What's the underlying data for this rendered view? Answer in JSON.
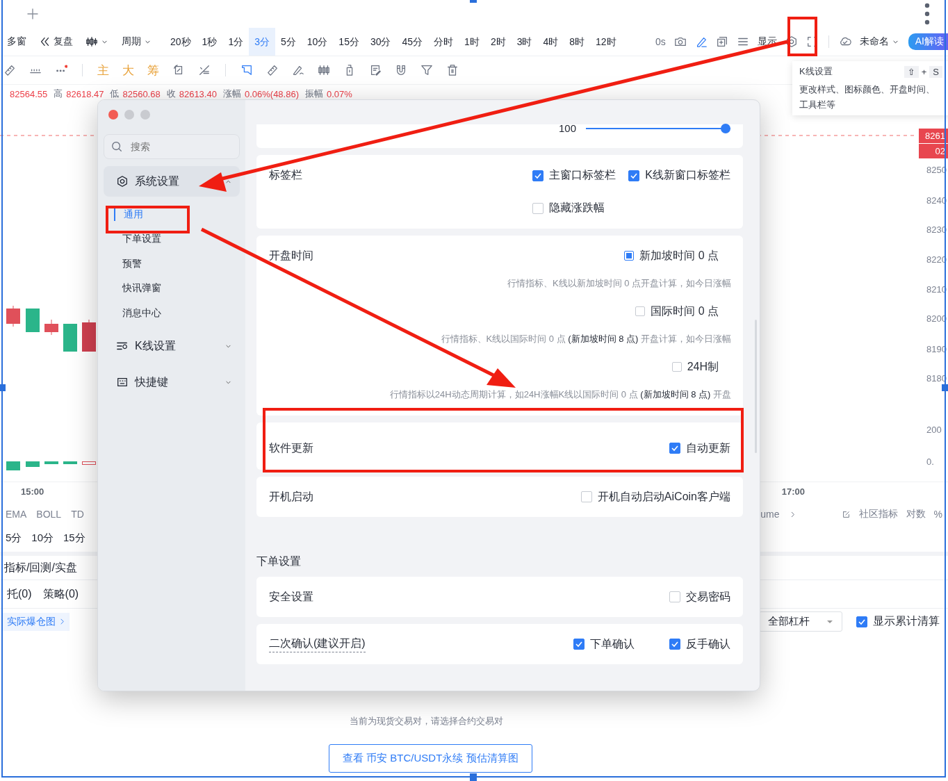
{
  "toolbar": {
    "window_button": "多窗",
    "replay_button": "复盘",
    "period_dropdown": "周期",
    "periods": [
      {
        "label": "20秒",
        "selected": false
      },
      {
        "label": "1秒",
        "selected": false
      },
      {
        "label": "1分",
        "selected": false
      },
      {
        "label": "3分",
        "selected": true
      },
      {
        "label": "5分",
        "selected": false
      },
      {
        "label": "10分",
        "selected": false
      },
      {
        "label": "15分",
        "selected": false
      },
      {
        "label": "30分",
        "selected": false
      },
      {
        "label": "45分",
        "selected": false
      },
      {
        "label": "分时",
        "selected": false
      },
      {
        "label": "1时",
        "selected": false
      },
      {
        "label": "2时",
        "selected": false
      },
      {
        "label": "3时",
        "selected": false
      },
      {
        "label": "4时",
        "selected": false
      },
      {
        "label": "8时",
        "selected": false
      },
      {
        "label": "12时",
        "selected": false
      }
    ],
    "countdown": "0s",
    "display_button": "显示",
    "layout_name": "未命名",
    "ai_button": "AI解读"
  },
  "drawing_toolbar": {
    "text_tools": [
      "主",
      "大",
      "筹"
    ]
  },
  "price_info": [
    {
      "value": "82564.55"
    },
    {
      "label": "高",
      "value": "82618.47"
    },
    {
      "label": "低",
      "value": "82560.68"
    },
    {
      "label": "收",
      "value": "82613.40"
    },
    {
      "label": "涨幅",
      "value": "0.06%(48.86)"
    },
    {
      "label": "振幅",
      "value": "0.07%"
    }
  ],
  "tooltip": {
    "title": "K线设置",
    "shortcut_keys": [
      "⇧",
      "S"
    ],
    "shortcut_joiner": "+",
    "description": "更改样式、图标颜色、开盘时间、工具栏等"
  },
  "chart": {
    "price_tags": [
      "8261",
      "02"
    ],
    "price_axis": [
      "8250",
      "8240",
      "8230",
      "8220",
      "8210",
      "8200",
      "8190",
      "8180"
    ],
    "volume_axis": [
      "200",
      "0."
    ],
    "time_axis": [
      "15:00",
      "17:00"
    ]
  },
  "indicator_bar": {
    "indicators": [
      "EMA",
      "BOLL",
      "TD"
    ],
    "cut_indicator": "ume",
    "community_button": "社区指标",
    "log_button": "对数",
    "percent_button": "%"
  },
  "period_row": [
    "5分",
    "10分",
    "15分"
  ],
  "panel_title": "指标/回测/实盘",
  "order_tabs": [
    "托(0)",
    "策略(0)"
  ],
  "liquidation": {
    "map_link": "实际爆仓图",
    "leverage_dropdown": "全部杠杆",
    "show_cumulative": {
      "label": "显示累计清算",
      "checked": true
    },
    "notice": "当前为现货交易对，请选择合约交易对",
    "view_button": "查看 币安 BTC/USDT永续 预估清算图"
  },
  "settings_dialog": {
    "search": {
      "placeholder": "搜索"
    },
    "nav": [
      {
        "label": "系统设置",
        "expanded": true,
        "children": [
          {
            "label": "通用",
            "selected": true
          },
          {
            "label": "下单设置",
            "selected": false
          },
          {
            "label": "预警",
            "selected": false
          },
          {
            "label": "快讯弹窗",
            "selected": false
          },
          {
            "label": "消息中心",
            "selected": false
          }
        ]
      },
      {
        "label": "K线设置",
        "expanded": false
      },
      {
        "label": "快捷键",
        "expanded": false
      }
    ],
    "sections": [
      {
        "cards": [
          {
            "kind": "slider",
            "reading": "100",
            "level": 1
          },
          {
            "kind": "checkboxes",
            "label": "标签栏",
            "options": [
              {
                "label": "主窗口标签栏",
                "checked": true
              },
              {
                "label": "K线新窗口标签栏",
                "checked": true
              },
              {
                "label": "隐藏涨跌幅",
                "checked": false
              }
            ]
          },
          {
            "kind": "choices",
            "label": "开盘时间",
            "options": [
              {
                "label": "新加坡时间 0 点",
                "selected": true,
                "note": "行情指标、K线以新加坡时间 0 点开盘计算，如今日涨幅"
              },
              {
                "label": "国际时间 0 点",
                "selected": false,
                "note": "行情指标、K线以国际时间 0 点 **(新加坡时间 8 点)** 开盘计算，如今日涨幅"
              },
              {
                "label": "24H制",
                "selected": false,
                "note": "行情指标以24H动态周期计算，如24H涨幅K线以国际时间 0 点 **(新加坡时间 8 点)** 开盘"
              }
            ]
          },
          {
            "kind": "checkboxes",
            "label": "软件更新",
            "options": [
              {
                "label": "自动更新",
                "checked": true
              }
            ]
          },
          {
            "kind": "checkboxes",
            "label": "开机启动",
            "options": [
              {
                "label": "开机自动启动AiCoin客户端",
                "checked": false
              }
            ]
          }
        ]
      },
      {
        "title": "下单设置",
        "cards": [
          {
            "kind": "checkboxes",
            "label": "安全设置",
            "options": [
              {
                "label": "交易密码",
                "checked": false
              }
            ]
          },
          {
            "kind": "checkboxes",
            "label": "二次确认(建议开启)",
            "has_help": true,
            "options": [
              {
                "label": "下单确认",
                "checked": true
              },
              {
                "label": "反手确认",
                "checked": true
              }
            ]
          }
        ]
      }
    ]
  }
}
